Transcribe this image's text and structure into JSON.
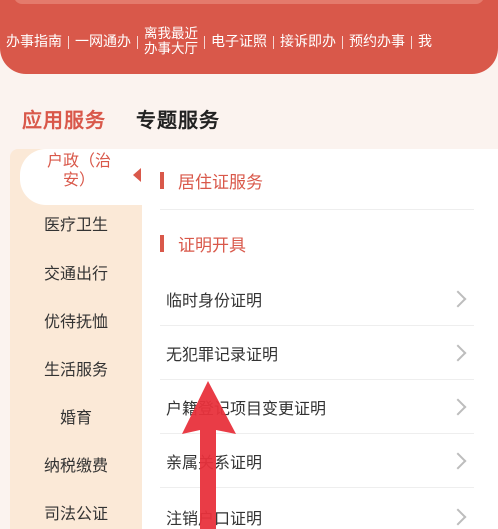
{
  "top_nav": {
    "items": [
      "办事指南",
      "一网通办",
      "离我最近\n办事大厅",
      "电子证照",
      "接诉即办",
      "预约办事",
      "我"
    ]
  },
  "tabs": {
    "active": "应用服务",
    "inactive": "专题服务"
  },
  "categories": {
    "active": "户政（治\n安）",
    "items": [
      "医疗卫生",
      "交通出行",
      "优待抚恤",
      "生活服务",
      "婚育",
      "纳税缴费",
      "司法公证"
    ]
  },
  "content": {
    "sections": [
      {
        "title": "居住证服务",
        "rows": []
      },
      {
        "title": "证明开具",
        "rows": [
          "临时身份证明",
          "无犯罪记录证明",
          "户籍登记项目变更证明",
          "亲属关系证明",
          "注销户口证明"
        ]
      }
    ]
  },
  "colors": {
    "brand_red": "#d9584a",
    "category_bg": "#fbe9d7",
    "annotation_arrow": "#e8323c"
  }
}
